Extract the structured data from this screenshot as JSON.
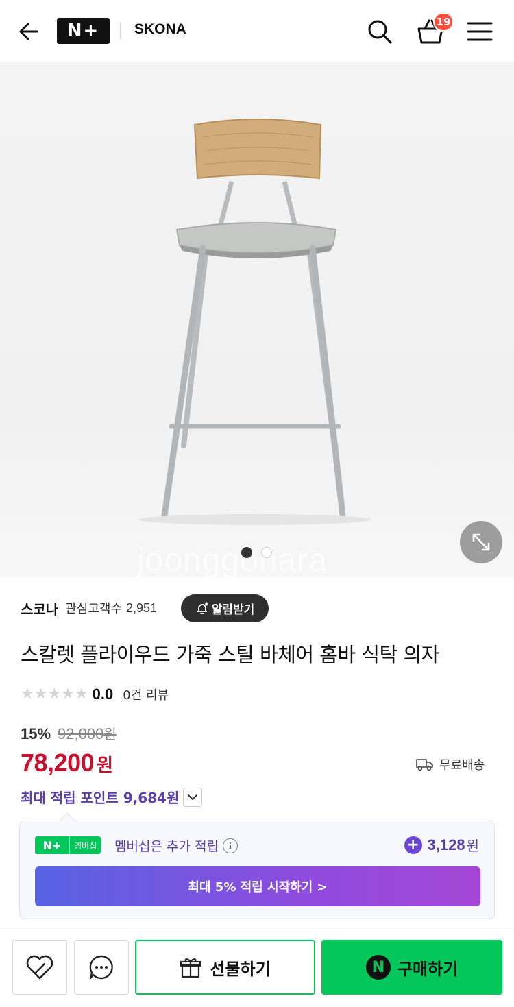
{
  "header": {
    "logo_text": "N+",
    "store_name": "SKONA",
    "cart_count": "19"
  },
  "gallery": {
    "watermark": "joonggonara",
    "page_count": 2,
    "active_page": 1
  },
  "store": {
    "name": "스코나",
    "follower_label": "관심고객수",
    "follower_count": "2,951",
    "notify_label": "알림받기"
  },
  "product": {
    "title": "스칼렛 플라이우드 가죽 스틸 바체어 홈바 식탁 의자",
    "rating": "0.0",
    "review_text": "0건 리뷰",
    "discount_rate": "15%",
    "original_price": "92,000",
    "original_currency": "원",
    "sale_price": "78,200",
    "sale_currency": "원",
    "shipping": "무료배송",
    "points_text": "최대 적립 포인트 9,684원"
  },
  "membership": {
    "badge_n": "N+",
    "badge_label": "멤버십",
    "text": "멤버십은 추가 적립",
    "info_icon": "i",
    "points_value": "3,128",
    "points_currency": "원",
    "cta_label": "최대 5% 적립 시작하기 >"
  },
  "bottom_bar": {
    "gift_label": "선물하기",
    "buy_label": "구매하기",
    "buy_icon_text": "N"
  },
  "colors": {
    "accent_green": "#03c75a",
    "sale_red": "#c8102e",
    "points_purple": "#5b3ea8",
    "badge_red": "#ff4d3a"
  }
}
